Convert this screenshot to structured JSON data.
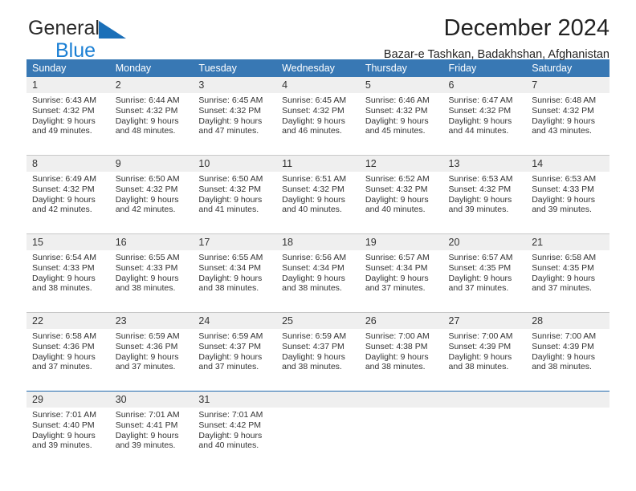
{
  "brand": {
    "name_top": "General",
    "name_bottom": "Blue",
    "triangle_icon": "blue-triangle-logo-mark",
    "color_top": "#2b2b2b",
    "color_bottom": "#1a7fd4"
  },
  "header": {
    "title": "December 2024",
    "subtitle": "Bazar-e Tashkan, Badakhshan, Afghanistan"
  },
  "theme": {
    "header_bg": "#3878b4",
    "header_text": "#ffffff",
    "daynum_bg": "#efefef",
    "separator": "#c8c8c8",
    "separator_blue": "#1f69ad"
  },
  "calendar": {
    "weekday_headers": [
      "Sunday",
      "Monday",
      "Tuesday",
      "Wednesday",
      "Thursday",
      "Friday",
      "Saturday"
    ],
    "weeks": [
      {
        "days": [
          {
            "num": "1",
            "sunrise": "Sunrise: 6:43 AM",
            "sunset": "Sunset: 4:32 PM",
            "daylight1": "Daylight: 9 hours",
            "daylight2": "and 49 minutes."
          },
          {
            "num": "2",
            "sunrise": "Sunrise: 6:44 AM",
            "sunset": "Sunset: 4:32 PM",
            "daylight1": "Daylight: 9 hours",
            "daylight2": "and 48 minutes."
          },
          {
            "num": "3",
            "sunrise": "Sunrise: 6:45 AM",
            "sunset": "Sunset: 4:32 PM",
            "daylight1": "Daylight: 9 hours",
            "daylight2": "and 47 minutes."
          },
          {
            "num": "4",
            "sunrise": "Sunrise: 6:45 AM",
            "sunset": "Sunset: 4:32 PM",
            "daylight1": "Daylight: 9 hours",
            "daylight2": "and 46 minutes."
          },
          {
            "num": "5",
            "sunrise": "Sunrise: 6:46 AM",
            "sunset": "Sunset: 4:32 PM",
            "daylight1": "Daylight: 9 hours",
            "daylight2": "and 45 minutes."
          },
          {
            "num": "6",
            "sunrise": "Sunrise: 6:47 AM",
            "sunset": "Sunset: 4:32 PM",
            "daylight1": "Daylight: 9 hours",
            "daylight2": "and 44 minutes."
          },
          {
            "num": "7",
            "sunrise": "Sunrise: 6:48 AM",
            "sunset": "Sunset: 4:32 PM",
            "daylight1": "Daylight: 9 hours",
            "daylight2": "and 43 minutes."
          }
        ]
      },
      {
        "days": [
          {
            "num": "8",
            "sunrise": "Sunrise: 6:49 AM",
            "sunset": "Sunset: 4:32 PM",
            "daylight1": "Daylight: 9 hours",
            "daylight2": "and 42 minutes."
          },
          {
            "num": "9",
            "sunrise": "Sunrise: 6:50 AM",
            "sunset": "Sunset: 4:32 PM",
            "daylight1": "Daylight: 9 hours",
            "daylight2": "and 42 minutes."
          },
          {
            "num": "10",
            "sunrise": "Sunrise: 6:50 AM",
            "sunset": "Sunset: 4:32 PM",
            "daylight1": "Daylight: 9 hours",
            "daylight2": "and 41 minutes."
          },
          {
            "num": "11",
            "sunrise": "Sunrise: 6:51 AM",
            "sunset": "Sunset: 4:32 PM",
            "daylight1": "Daylight: 9 hours",
            "daylight2": "and 40 minutes."
          },
          {
            "num": "12",
            "sunrise": "Sunrise: 6:52 AM",
            "sunset": "Sunset: 4:32 PM",
            "daylight1": "Daylight: 9 hours",
            "daylight2": "and 40 minutes."
          },
          {
            "num": "13",
            "sunrise": "Sunrise: 6:53 AM",
            "sunset": "Sunset: 4:32 PM",
            "daylight1": "Daylight: 9 hours",
            "daylight2": "and 39 minutes."
          },
          {
            "num": "14",
            "sunrise": "Sunrise: 6:53 AM",
            "sunset": "Sunset: 4:33 PM",
            "daylight1": "Daylight: 9 hours",
            "daylight2": "and 39 minutes."
          }
        ]
      },
      {
        "days": [
          {
            "num": "15",
            "sunrise": "Sunrise: 6:54 AM",
            "sunset": "Sunset: 4:33 PM",
            "daylight1": "Daylight: 9 hours",
            "daylight2": "and 38 minutes."
          },
          {
            "num": "16",
            "sunrise": "Sunrise: 6:55 AM",
            "sunset": "Sunset: 4:33 PM",
            "daylight1": "Daylight: 9 hours",
            "daylight2": "and 38 minutes."
          },
          {
            "num": "17",
            "sunrise": "Sunrise: 6:55 AM",
            "sunset": "Sunset: 4:34 PM",
            "daylight1": "Daylight: 9 hours",
            "daylight2": "and 38 minutes."
          },
          {
            "num": "18",
            "sunrise": "Sunrise: 6:56 AM",
            "sunset": "Sunset: 4:34 PM",
            "daylight1": "Daylight: 9 hours",
            "daylight2": "and 38 minutes."
          },
          {
            "num": "19",
            "sunrise": "Sunrise: 6:57 AM",
            "sunset": "Sunset: 4:34 PM",
            "daylight1": "Daylight: 9 hours",
            "daylight2": "and 37 minutes."
          },
          {
            "num": "20",
            "sunrise": "Sunrise: 6:57 AM",
            "sunset": "Sunset: 4:35 PM",
            "daylight1": "Daylight: 9 hours",
            "daylight2": "and 37 minutes."
          },
          {
            "num": "21",
            "sunrise": "Sunrise: 6:58 AM",
            "sunset": "Sunset: 4:35 PM",
            "daylight1": "Daylight: 9 hours",
            "daylight2": "and 37 minutes."
          }
        ]
      },
      {
        "days": [
          {
            "num": "22",
            "sunrise": "Sunrise: 6:58 AM",
            "sunset": "Sunset: 4:36 PM",
            "daylight1": "Daylight: 9 hours",
            "daylight2": "and 37 minutes."
          },
          {
            "num": "23",
            "sunrise": "Sunrise: 6:59 AM",
            "sunset": "Sunset: 4:36 PM",
            "daylight1": "Daylight: 9 hours",
            "daylight2": "and 37 minutes."
          },
          {
            "num": "24",
            "sunrise": "Sunrise: 6:59 AM",
            "sunset": "Sunset: 4:37 PM",
            "daylight1": "Daylight: 9 hours",
            "daylight2": "and 37 minutes."
          },
          {
            "num": "25",
            "sunrise": "Sunrise: 6:59 AM",
            "sunset": "Sunset: 4:37 PM",
            "daylight1": "Daylight: 9 hours",
            "daylight2": "and 38 minutes."
          },
          {
            "num": "26",
            "sunrise": "Sunrise: 7:00 AM",
            "sunset": "Sunset: 4:38 PM",
            "daylight1": "Daylight: 9 hours",
            "daylight2": "and 38 minutes."
          },
          {
            "num": "27",
            "sunrise": "Sunrise: 7:00 AM",
            "sunset": "Sunset: 4:39 PM",
            "daylight1": "Daylight: 9 hours",
            "daylight2": "and 38 minutes."
          },
          {
            "num": "28",
            "sunrise": "Sunrise: 7:00 AM",
            "sunset": "Sunset: 4:39 PM",
            "daylight1": "Daylight: 9 hours",
            "daylight2": "and 38 minutes."
          }
        ]
      },
      {
        "days": [
          {
            "num": "29",
            "sunrise": "Sunrise: 7:01 AM",
            "sunset": "Sunset: 4:40 PM",
            "daylight1": "Daylight: 9 hours",
            "daylight2": "and 39 minutes."
          },
          {
            "num": "30",
            "sunrise": "Sunrise: 7:01 AM",
            "sunset": "Sunset: 4:41 PM",
            "daylight1": "Daylight: 9 hours",
            "daylight2": "and 39 minutes."
          },
          {
            "num": "31",
            "sunrise": "Sunrise: 7:01 AM",
            "sunset": "Sunset: 4:42 PM",
            "daylight1": "Daylight: 9 hours",
            "daylight2": "and 40 minutes."
          },
          {
            "num": "",
            "sunrise": "",
            "sunset": "",
            "daylight1": "",
            "daylight2": ""
          },
          {
            "num": "",
            "sunrise": "",
            "sunset": "",
            "daylight1": "",
            "daylight2": ""
          },
          {
            "num": "",
            "sunrise": "",
            "sunset": "",
            "daylight1": "",
            "daylight2": ""
          },
          {
            "num": "",
            "sunrise": "",
            "sunset": "",
            "daylight1": "",
            "daylight2": ""
          }
        ]
      }
    ]
  }
}
